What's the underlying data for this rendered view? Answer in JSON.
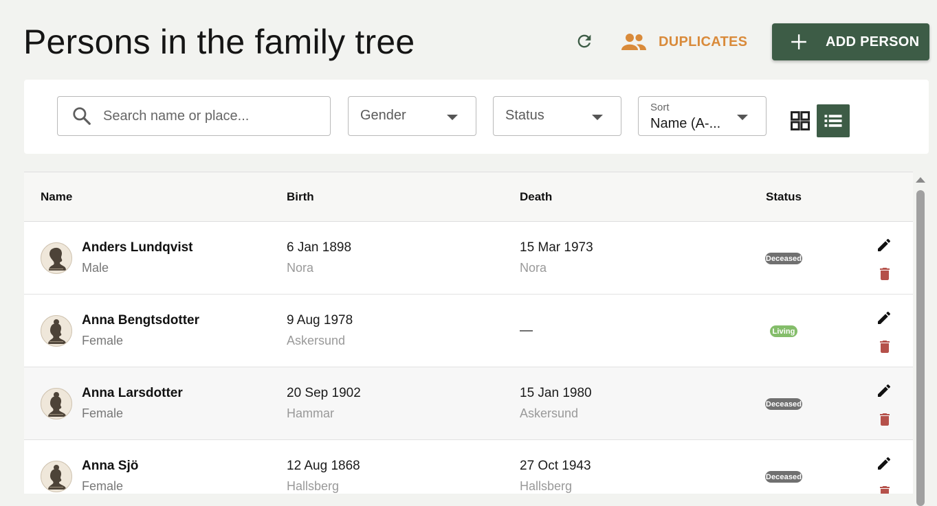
{
  "header": {
    "title": "Persons in the family tree",
    "duplicates_label": "DUPLICATES",
    "add_person_label": "ADD PERSON"
  },
  "filters": {
    "search_placeholder": "Search name or place...",
    "gender_label": "Gender",
    "status_label": "Status",
    "sort_label": "Sort",
    "sort_value": "Name (A-..."
  },
  "table": {
    "columns": {
      "name": "Name",
      "birth": "Birth",
      "death": "Death",
      "status": "Status"
    },
    "rows": [
      {
        "name": "Anders Lundqvist",
        "gender": "Male",
        "birth_date": "6 Jan 1898",
        "birth_place": "Nora",
        "death_date": "15 Mar 1973",
        "death_place": "Nora",
        "status": "Deceased"
      },
      {
        "name": "Anna Bengtsdotter",
        "gender": "Female",
        "birth_date": "9 Aug 1978",
        "birth_place": "Askersund",
        "death_date": "—",
        "death_place": "",
        "status": "Living"
      },
      {
        "name": "Anna Larsdotter",
        "gender": "Female",
        "birth_date": "20 Sep 1902",
        "birth_place": "Hammar",
        "death_date": "15 Jan 1980",
        "death_place": "Askersund",
        "status": "Deceased"
      },
      {
        "name": "Anna Sjö",
        "gender": "Female",
        "birth_date": "12 Aug 1868",
        "birth_place": "Hallsberg",
        "death_date": "27 Oct 1943",
        "death_place": "Hallsberg",
        "status": "Deceased"
      }
    ]
  },
  "colors": {
    "primary": "#3d5c46",
    "accent": "#d98a3a",
    "danger": "#b5514a",
    "deceased_badge": "#707070",
    "living_badge": "#84bd6a"
  },
  "icons": {
    "refresh": "refresh-icon",
    "duplicates": "people-icon",
    "add": "plus-icon",
    "search": "search-icon",
    "grid_view": "grid-view-icon",
    "list_view": "list-view-icon",
    "edit": "pencil-icon",
    "delete": "trash-icon"
  }
}
